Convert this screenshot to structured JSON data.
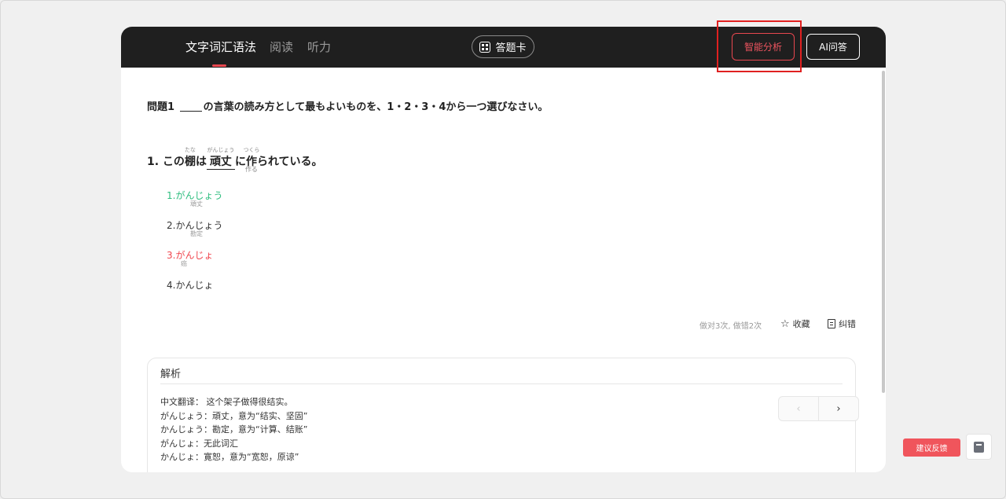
{
  "tabs": [
    {
      "label": "文字词汇语法",
      "active": true
    },
    {
      "label": "阅读",
      "active": false
    },
    {
      "label": "听力",
      "active": false
    }
  ],
  "answer_card_label": "答题卡",
  "smart_analysis_label": "智能分析",
  "ai_qa_label": "AI问答",
  "question": {
    "header_prefix": "問題1",
    "header_text": "の言葉の読み方として最もよいものを、1・2・3・4から一つ選びなさい。",
    "sentence": {
      "number": "1.",
      "part1": "この",
      "word1": "棚",
      "word1_ruby": "たな",
      "part2": "は",
      "word2": "頑丈",
      "word2_ruby": "がんじょう",
      "part3": "に",
      "word3": "作",
      "word3_ruby": "つくら",
      "word3_below": "作る",
      "part4": "られている。"
    },
    "options": [
      {
        "label": "1.がんじょう",
        "kanji": "頑丈",
        "status": "correct"
      },
      {
        "label": "2.かんじょう",
        "kanji": "勘定",
        "status": "normal"
      },
      {
        "label": "3.がんじょ",
        "kanji": "癌",
        "status": "wrong"
      },
      {
        "label": "4.かんじょ",
        "kanji": "",
        "status": "normal"
      }
    ]
  },
  "stats_text": "做对3次, 做错2次",
  "favorite_label": "收藏",
  "correction_label": "纠错",
  "analysis": {
    "title": "解析",
    "lines": [
      "中文翻译： 这个架子做得很结实。",
      "がんじょう：頑丈，意为“结实、坚固”",
      "かんじょう：勘定，意为“计算、结账”",
      "がんじょ：无此词汇",
      "かんじょ：寛恕，意为“宽恕，原谅”"
    ]
  },
  "pager": {
    "prev": "‹",
    "next": "›"
  },
  "feedback_label": "建议反馈",
  "colors": {
    "accent": "#e8474f",
    "correct": "#2dbd7e",
    "topbar": "#1f1f1f"
  }
}
